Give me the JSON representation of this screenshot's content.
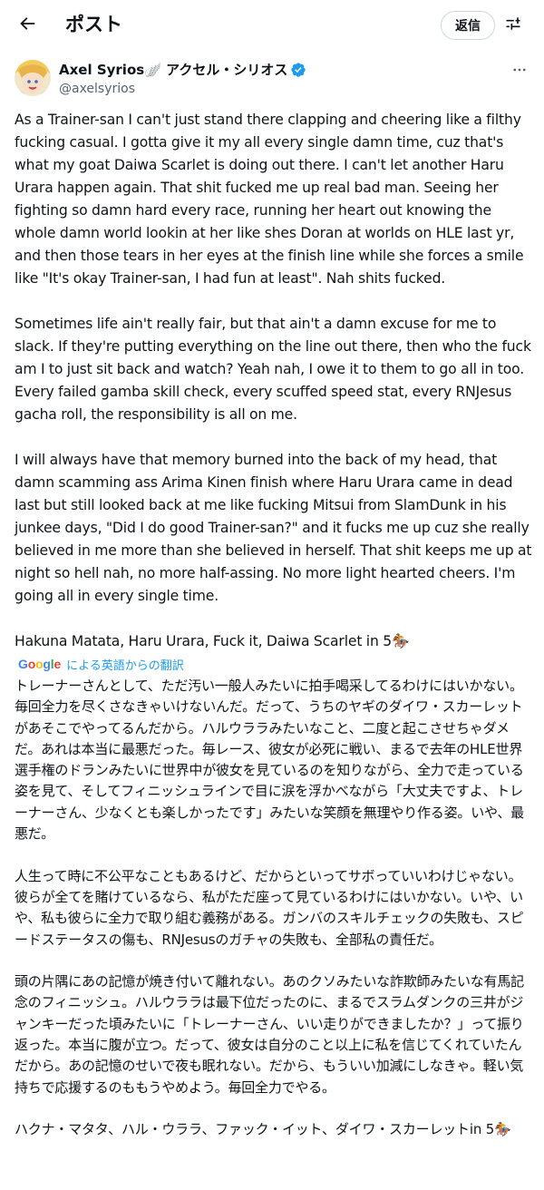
{
  "header": {
    "title": "ポスト",
    "reply_label": "返信"
  },
  "author": {
    "display_name": "Axel Syrios🪽 アクセル・シリオス",
    "handle": "@axelsyrios"
  },
  "tweet": {
    "text": "As a Trainer-san I can't just stand there clapping and cheering like a filthy fucking casual. I gotta give it my all every single damn time, cuz that's what my goat Daiwa Scarlet is doing out there. I can't let another Haru Urara happen again. That shit fucked me up real bad man. Seeing her fighting so damn hard every race, running her heart out knowing the whole damn world lookin at her like shes Doran at worlds on HLE last yr, and then those tears in her eyes at the finish line while she forces a smile like \"It's okay Trainer-san, I had fun at least\". Nah shits fucked.\n\nSometimes life ain't really fair, but that ain't a damn excuse for me to slack. If they're putting everything on the line out there, then who the fuck am I to just sit back and watch? Yeah nah, I owe it to them to go all in too. Every failed gamba skill check, every scuffed speed stat, every RNJesus gacha roll, the responsibility is all on me.\n\nI will always have that memory burned into the back of my head, that damn scamming ass Arima Kinen finish where Haru Urara came in dead last but still looked back at me like fucking Mitsui from SlamDunk in his junkee days, \"Did I do good Trainer-san?\" and it fucks me up cuz she really believed in me more than she believed in herself. That shit keeps me up at night so hell nah, no more half-assing. No more light hearted cheers. I'm going all in every single time.\n\nHakuna Matata, Haru Urara, Fuck it, Daiwa Scarlet in 5🏇"
  },
  "translation": {
    "logo_text": "Google",
    "translated_by": "による英語からの翻訳",
    "text": "トレーナーさんとして、ただ汚い一般人みたいに拍手喝采してるわけにはいかない。毎回全力を尽くさなきゃいけないんだ。だって、うちのヤギのダイワ・スカーレットがあそこでやってるんだから。ハルウララみたいなこと、二度と起こさせちゃダメだ。あれは本当に最悪だった。毎レース、彼女が必死に戦い、まるで去年のHLE世界選手権のドランみたいに世界中が彼女を見ているのを知りながら、全力で走っている姿を見て、そしてフィニッシュラインで目に涙を浮かべながら「大丈夫ですよ、トレーナーさん、少なくとも楽しかったです」みたいな笑顔を無理やり作る姿。いや、最悪だ。\n\n人生って時に不公平なこともあるけど、だからといってサボっていいわけじゃない。彼らが全てを賭けているなら、私がただ座って見ているわけにはいかない。いや、いや、私も彼らに全力で取り組む義務がある。ガンバのスキルチェックの失敗も、スピードステータスの傷も、RNJesusのガチャの失敗も、全部私の責任だ。\n\n頭の片隅にあの記憶が焼き付いて離れない。あのクソみたいな詐欺師みたいな有馬記念のフィニッシュ。ハルウララは最下位だったのに、まるでスラムダンクの三井がジャンキーだった頃みたいに「トレーナーさん、いい走りができましたか？」って振り返った。本当に腹が立つ。だって、彼女は自分のこと以上に私を信じてくれていたんだから。あの記憶のせいで夜も眠れない。だから、もういい加減にしなきゃ。軽い気持ちで応援するのももうやめよう。毎回全力でやる。\n\nハクナ・マタタ、ハル・ウララ、ファック・イット、ダイワ・スカーレットin 5🏇"
  },
  "icons": {
    "back": "arrow-left-icon",
    "settings": "sliders-icon",
    "more": "more-horizontal-icon",
    "verified": "verified-badge-icon"
  },
  "colors": {
    "verified_blue": "#1d9bf0",
    "link_blue": "#1d9bf0",
    "secondary_text": "#536471"
  }
}
